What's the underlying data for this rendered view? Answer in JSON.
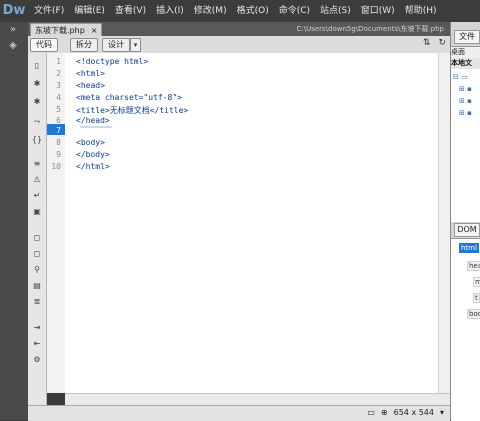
{
  "app": {
    "logo": "Dw"
  },
  "menu": [
    "文件(F)",
    "编辑(E)",
    "查看(V)",
    "插入(I)",
    "修改(M)",
    "格式(O)",
    "命令(C)",
    "站点(S)",
    "窗口(W)",
    "帮助(H)"
  ],
  "document": {
    "tab_title": "东坡下载.php",
    "close_glyph": "×",
    "path": "C:\\Users\\down5g\\Documents\\东坡下载.php"
  },
  "view_buttons": {
    "code": "代码",
    "split": "拆分",
    "design": "设计",
    "design_dropdown": "▾"
  },
  "toolbar_right_icons": [
    "file-management-icon",
    "refresh-icon"
  ],
  "code": {
    "line_numbers": [
      "1",
      "2",
      "3",
      "4",
      "5",
      "6",
      "7",
      "8",
      "9",
      "10"
    ],
    "active_line": "7",
    "lines": [
      "<!doctype html>",
      "<html>",
      "<head>",
      "<meta charset=\"utf-8\">",
      "<title>无标题文档</title>",
      "</head>",
      "",
      "<body>",
      "</body>",
      "</html>"
    ]
  },
  "status": {
    "dimensions": "654 x 544",
    "zoom_arrow": "▾"
  },
  "right_panel": {
    "files_tab": "文件",
    "files_header": "桌面",
    "local_label": "本地文",
    "dom_tab": "DOM",
    "dom_nodes": [
      "html",
      "hea",
      "m",
      "t",
      "bod"
    ]
  },
  "colors": {
    "accent": "#1e78d8",
    "menubar": "#3c3c3c",
    "code_text": "#0b3c9a"
  }
}
